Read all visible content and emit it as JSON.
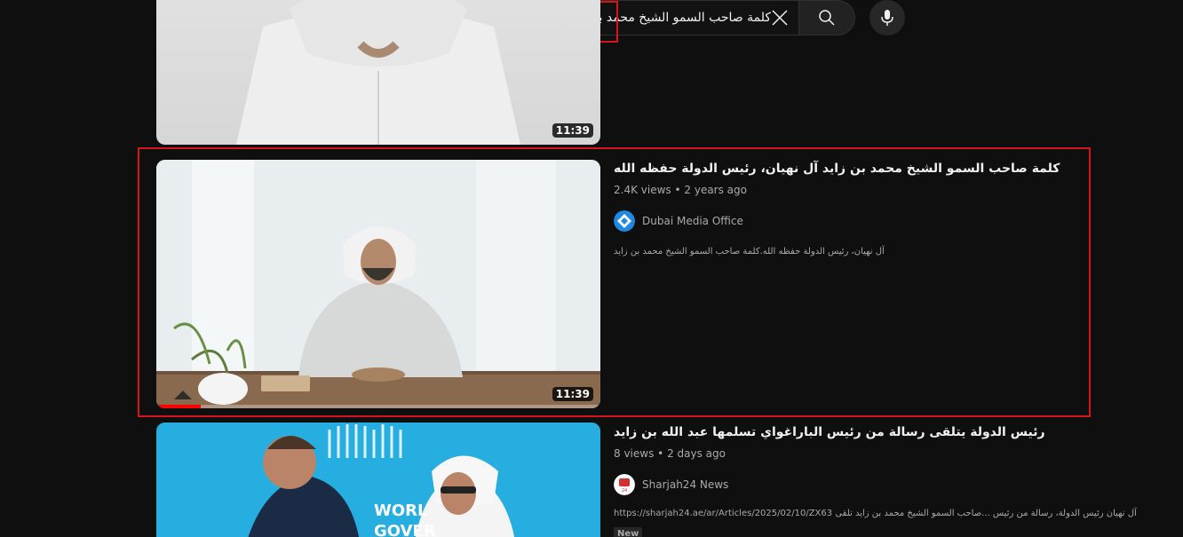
{
  "search": {
    "value": "كلمة صاحب السمو الشيخ محمد بن زايد",
    "clear_icon": "close-icon",
    "search_icon": "search-icon",
    "mic_icon": "microphone-icon"
  },
  "results": [
    {
      "duration": "11:39"
    },
    {
      "title": "كلمة صاحب السمو الشيخ محمد بن زايد آل نهيان، رئيس الدولة حفظه الله",
      "views": "2.4K views",
      "age": "2 years ago",
      "channel": "Dubai Media Office",
      "description": "آل نهيان، رئيس الدولة حفظه الله.كلمة صاحب السمو الشيخ محمد بن زايد",
      "duration": "11:39",
      "watched_fraction": 0.1,
      "avatar_color": "#1e88e5"
    },
    {
      "title": "رئيس الدولة يتلقى رسالة من رئيس الباراغواي تسلمها عبد الله بن زايد",
      "views": "8 views",
      "age": "2 days ago",
      "channel": "Sharjah24 News",
      "description": "آل نهيان رئيس الدولة، رسالة من رئيس ...صاحب السمو الشيخ محمد بن زايد تلقى https://sharjah24.ae/ar/Articles/2025/02/10/ZX63",
      "badge": "New",
      "avatar_color": "#d32f2f"
    }
  ],
  "colors": {
    "background": "#0f0f0f",
    "highlight_outline": "#d8141b",
    "progress": "#ff0000"
  }
}
